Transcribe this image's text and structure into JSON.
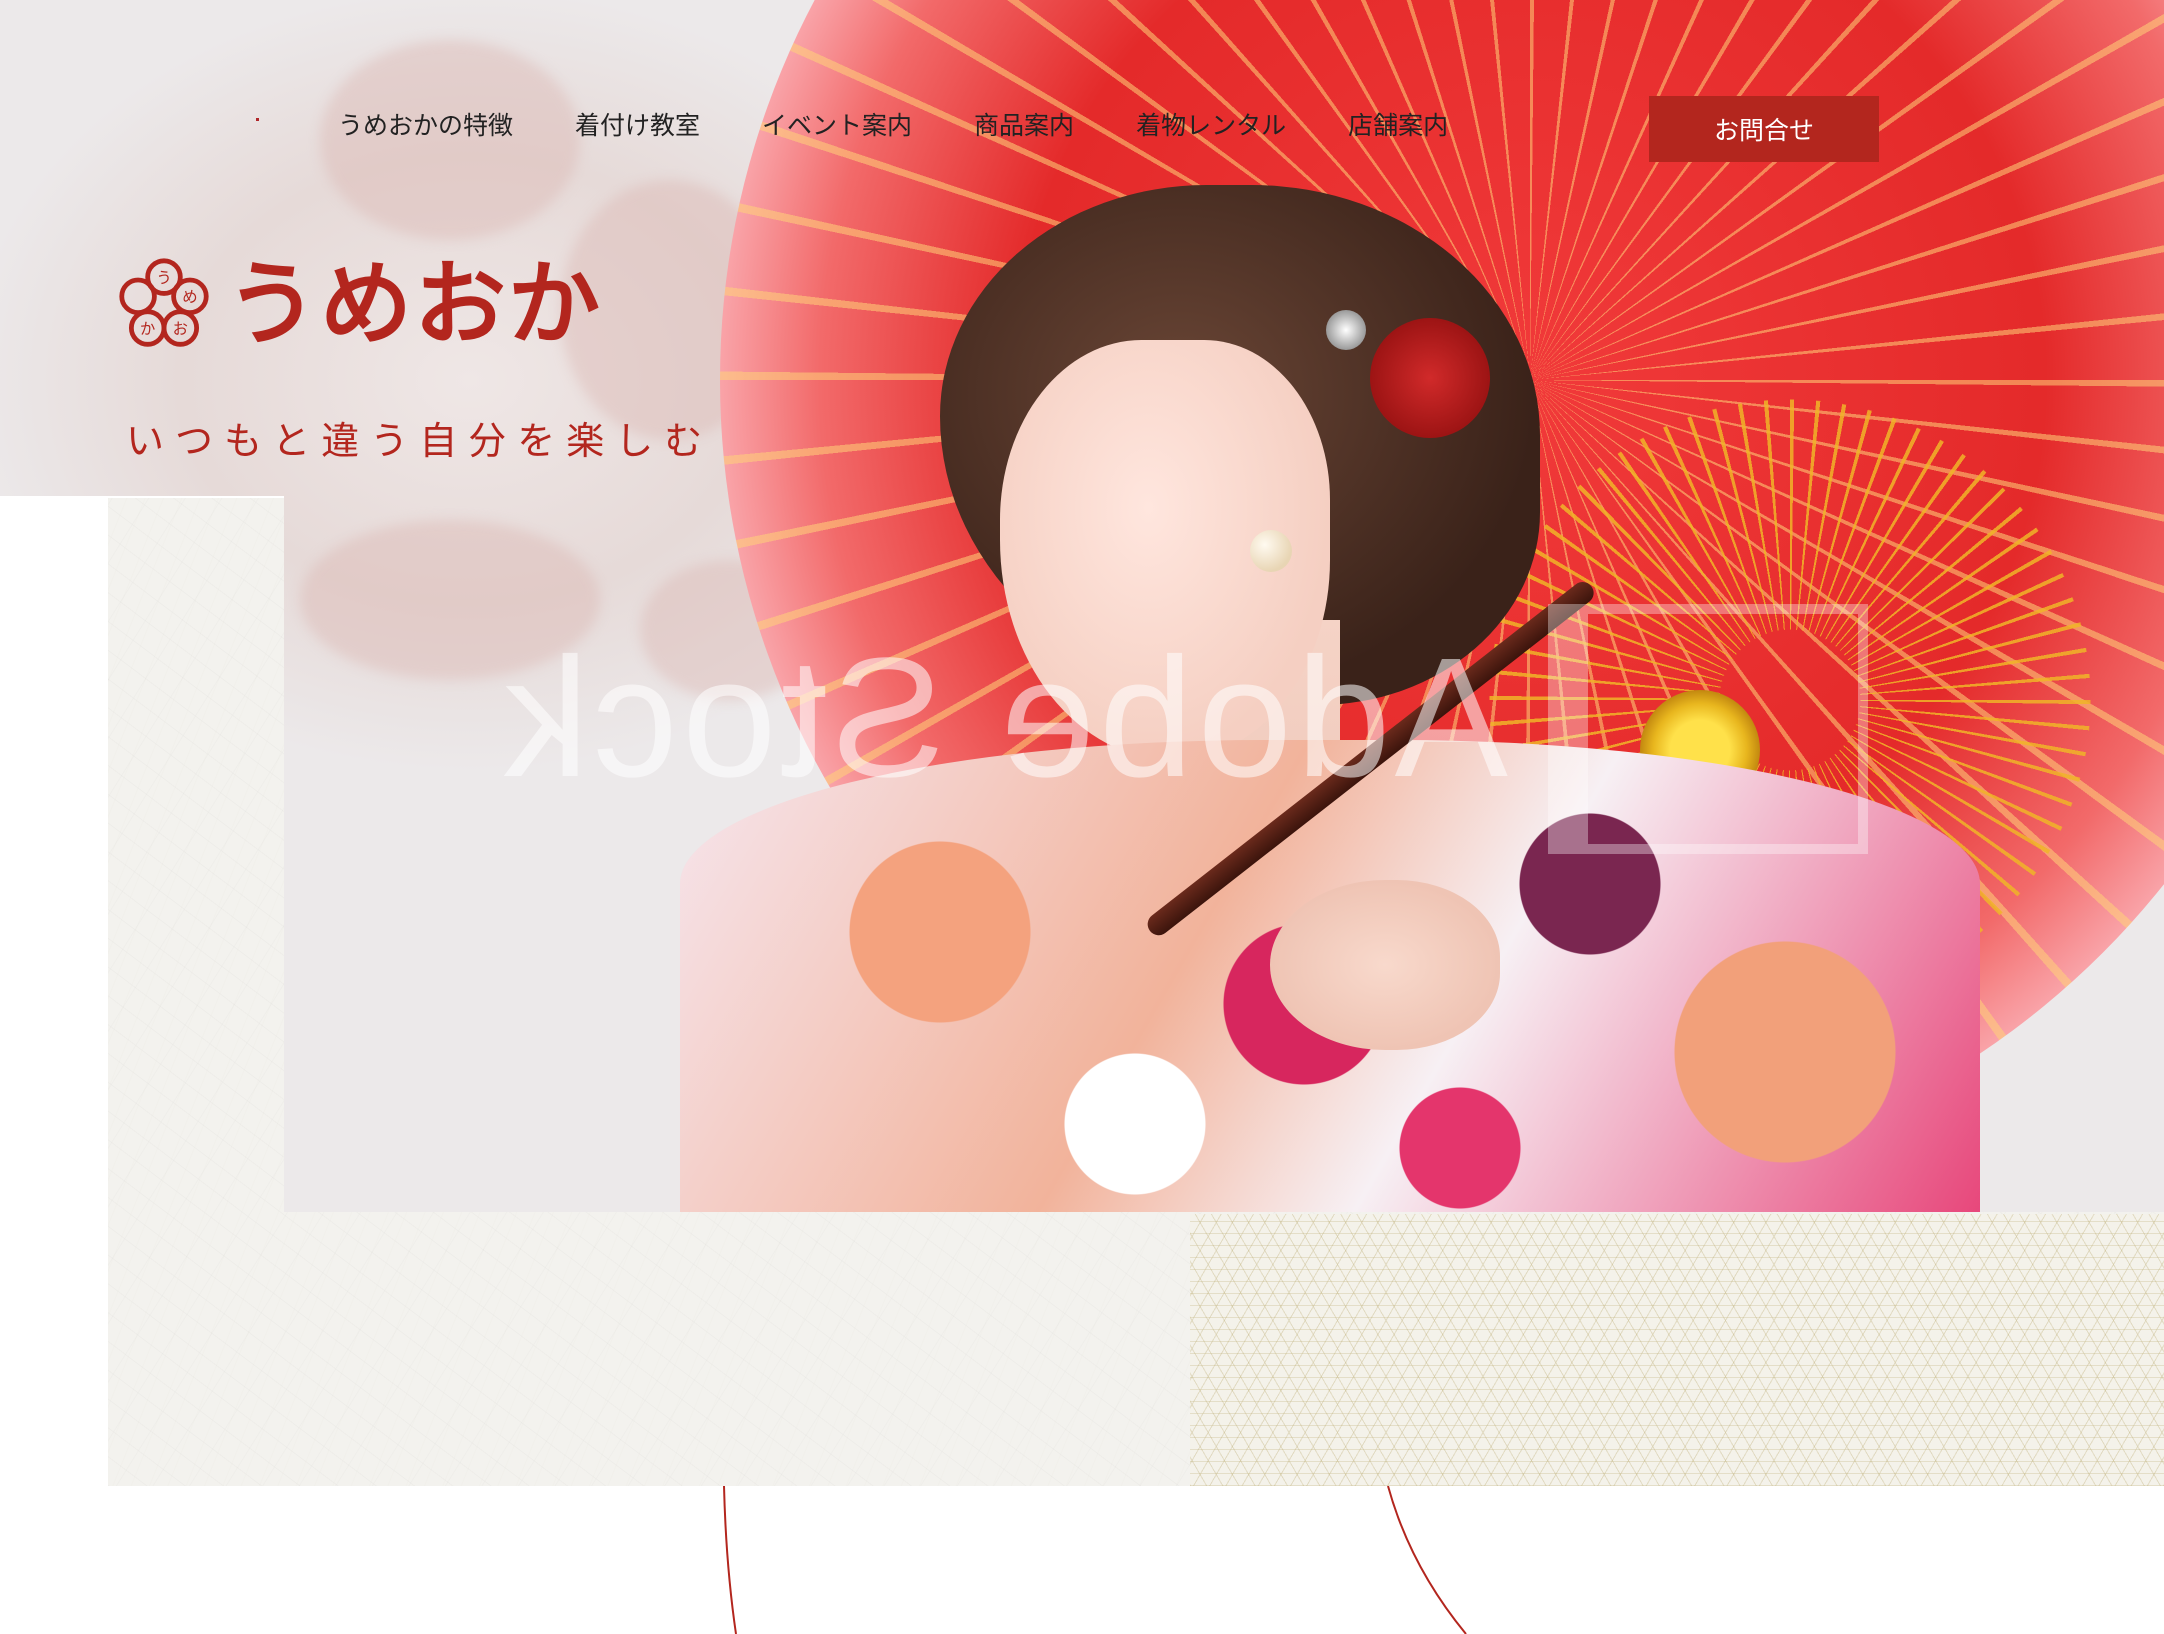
{
  "nav": {
    "items": [
      {
        "label": "うめおかの特徴"
      },
      {
        "label": "着付け教室"
      },
      {
        "label": "イベント案内"
      },
      {
        "label": "商品案内"
      },
      {
        "label": "着物レンタル"
      },
      {
        "label": "店舗案内"
      }
    ],
    "contact_label": "お問合せ"
  },
  "logo": {
    "text": "うめおか",
    "mark_chars": [
      "う",
      "め",
      "お",
      "か"
    ]
  },
  "tagline": "いつもと違う自分を楽しむ",
  "hero": {
    "watermark": "Adobe Stock"
  },
  "colors": {
    "brand": "#b3261e",
    "paper": "#f3f2ee",
    "asanoha": "#f4f2ea"
  },
  "icons": {
    "logo_mark": "plum-blossom-crest-icon"
  }
}
